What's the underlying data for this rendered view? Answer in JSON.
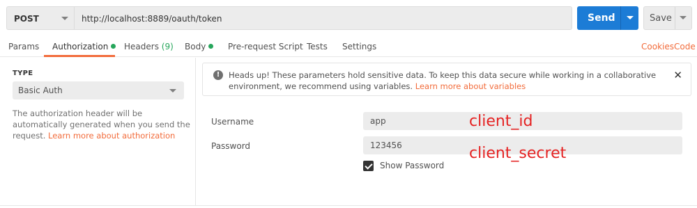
{
  "request": {
    "method": "POST",
    "url": "http://localhost:8889/oauth/token",
    "send_label": "Send",
    "save_label": "Save"
  },
  "tabs": [
    {
      "label": "Params"
    },
    {
      "label": "Authorization",
      "active": true,
      "dot": true
    },
    {
      "label": "Headers",
      "count": "(9)"
    },
    {
      "label": "Body",
      "dot": true
    },
    {
      "label": "Pre-request Script"
    },
    {
      "label": "Tests"
    },
    {
      "label": "Settings"
    }
  ],
  "right_links": {
    "cookies": "Cookies",
    "code": "Code"
  },
  "auth": {
    "type_label": "TYPE",
    "type_value": "Basic Auth",
    "description": "The authorization header will be automatically generated when you send the request.",
    "learn_more": "Learn more about authorization"
  },
  "notice": {
    "text": "Heads up! These parameters hold sensitive data. To keep this data secure while working in a collaborative environment, we recommend using variables.",
    "link": "Learn more about variables"
  },
  "fields": {
    "username_label": "Username",
    "username_value": "app",
    "password_label": "Password",
    "password_value": "123456",
    "show_password_label": "Show Password",
    "show_password_checked": true
  },
  "annotations": {
    "client_id": "client_id",
    "client_secret": "client_secret"
  },
  "colors": {
    "accent": "#f26b3a",
    "send": "#1c7cd6",
    "green": "#26a65b",
    "annotation": "#e52222"
  }
}
